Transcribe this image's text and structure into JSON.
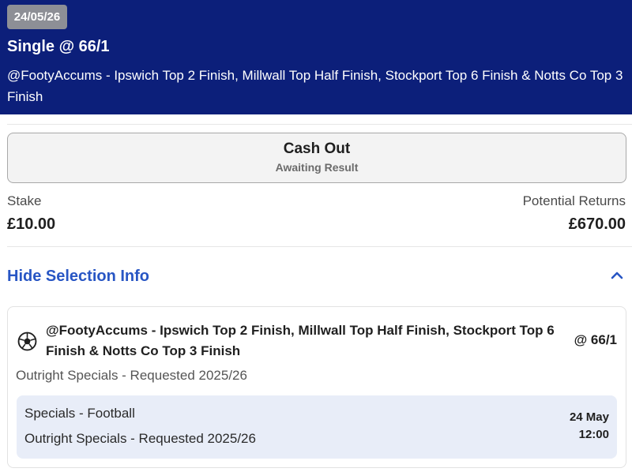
{
  "header": {
    "date": "24/05/26",
    "title": "Single @ 66/1",
    "description": "@FootyAccums - Ipswich Top 2 Finish, Millwall Top Half Finish, Stockport Top 6 Finish & Notts Co Top 3 Finish"
  },
  "cash_out": {
    "label": "Cash Out",
    "status": "Awaiting Result"
  },
  "stake": {
    "label": "Stake",
    "value": "£10.00"
  },
  "returns": {
    "label": "Potential Returns",
    "value": "£670.00"
  },
  "selection_toggle": {
    "label": "Hide Selection Info",
    "icon": "chevron-up-icon"
  },
  "selection": {
    "icon": "football-icon",
    "name": "@FootyAccums - Ipswich Top 2 Finish, Millwall Top Half Finish, Stockport Top 6 Finish & Notts Co Top 3 Finish",
    "odds": "@ 66/1",
    "market": "Outright Specials - Requested 2025/26",
    "event": {
      "sport": "Specials - Football",
      "market": "Outright Specials - Requested 2025/26",
      "date": "24 May",
      "time": "12:00"
    }
  },
  "colors": {
    "header_bg": "#0c1f7a",
    "link_blue": "#2856c4",
    "event_bg": "#e8edf8",
    "badge_bg": "#8d8f96"
  }
}
